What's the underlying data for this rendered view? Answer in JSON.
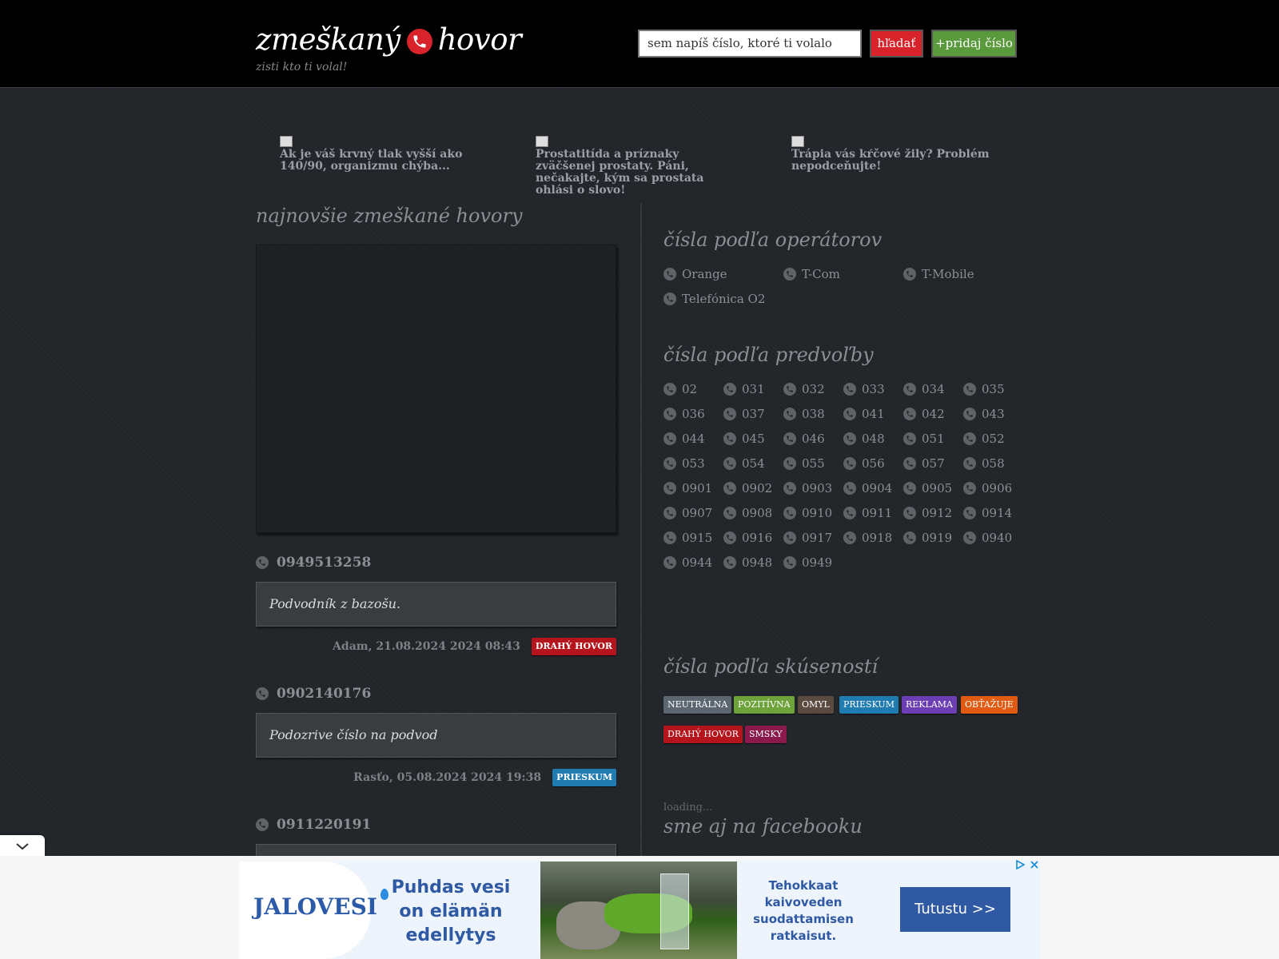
{
  "header": {
    "logo_part1": "zmeškaný",
    "logo_part2": "hovor",
    "tagline": "zisti kto ti volal!",
    "search_placeholder": "sem napíš číslo, ktoré ti volalo",
    "search_button": "hľadať",
    "add_button": "+pridaj číslo"
  },
  "promos": [
    {
      "text": "Ak je váš krvný tlak vyšší ako 140/90, organizmu chýba..."
    },
    {
      "text": "Prostatitída a príznaky zväčšenej prostaty. Páni, nečakajte, kým sa prostata ohlási o slovo!"
    },
    {
      "text": "Trápia vás kŕčové žily? Problém nepodceňujte!"
    }
  ],
  "latest": {
    "title": "najnovšie zmeškané hovory",
    "calls": [
      {
        "number": "0949513258",
        "comment": "Podvodník z bazošu.",
        "meta": "Adam, 21.08.2024 2024 08:43",
        "tag": "DRAHÝ HOVOR"
      },
      {
        "number": "0902140176",
        "comment": "Podozrive číslo na podvod",
        "meta": "Rasťo, 05.08.2024 2024 19:38",
        "tag": "PRIESKUM"
      },
      {
        "number": "0911220191"
      }
    ]
  },
  "operators": {
    "title": "čísla podľa operátorov",
    "items": [
      "Orange",
      "T-Com",
      "T-Mobile",
      "Telefónica O2"
    ]
  },
  "prefixes": {
    "title": "čísla podľa predvoľby",
    "items": [
      "02",
      "031",
      "032",
      "033",
      "034",
      "035",
      "036",
      "037",
      "038",
      "041",
      "042",
      "043",
      "044",
      "045",
      "046",
      "048",
      "051",
      "052",
      "053",
      "054",
      "055",
      "056",
      "057",
      "058",
      "0901",
      "0902",
      "0903",
      "0904",
      "0905",
      "0906",
      "0907",
      "0908",
      "0910",
      "0911",
      "0912",
      "0914",
      "0915",
      "0916",
      "0917",
      "0918",
      "0919",
      "0940",
      "0944",
      "0948",
      "0949"
    ]
  },
  "experience": {
    "title": "čísla podľa skúseností",
    "tags": [
      "NEUTRÁLNA",
      "POZITÍVNA",
      "OMYL",
      "PRIESKUM",
      "REKLAMA",
      "OBŤAŽUJE",
      "DRAHÝ HOVOR",
      "SMSKY"
    ]
  },
  "facebook": {
    "loading": "loading...",
    "title": "sme aj na facebooku"
  },
  "bottom_ad": {
    "brand": "JALOVESI",
    "headline": "Puhdas vesi on elämän edellytys",
    "subtext": "Tehokkaat kaivoveden suodattamisen ratkaisut.",
    "cta": "Tutustu >>"
  },
  "colors": {
    "brand_red": "#d9232a",
    "add_green": "#5a9a3c",
    "tag_neutral": "#5c6670",
    "tag_positive": "#6ea23a",
    "tag_mistake": "#5b4a40",
    "tag_survey": "#1f7bb0",
    "tag_ad": "#6c3eb3",
    "tag_annoy": "#e05a12",
    "tag_expensive": "#b5141c",
    "tag_sms": "#8a1a4c"
  },
  "icons": [
    "phone-icon",
    "image-placeholder-icon",
    "chevron-down-icon",
    "ad-choices-icon",
    "close-icon"
  ]
}
